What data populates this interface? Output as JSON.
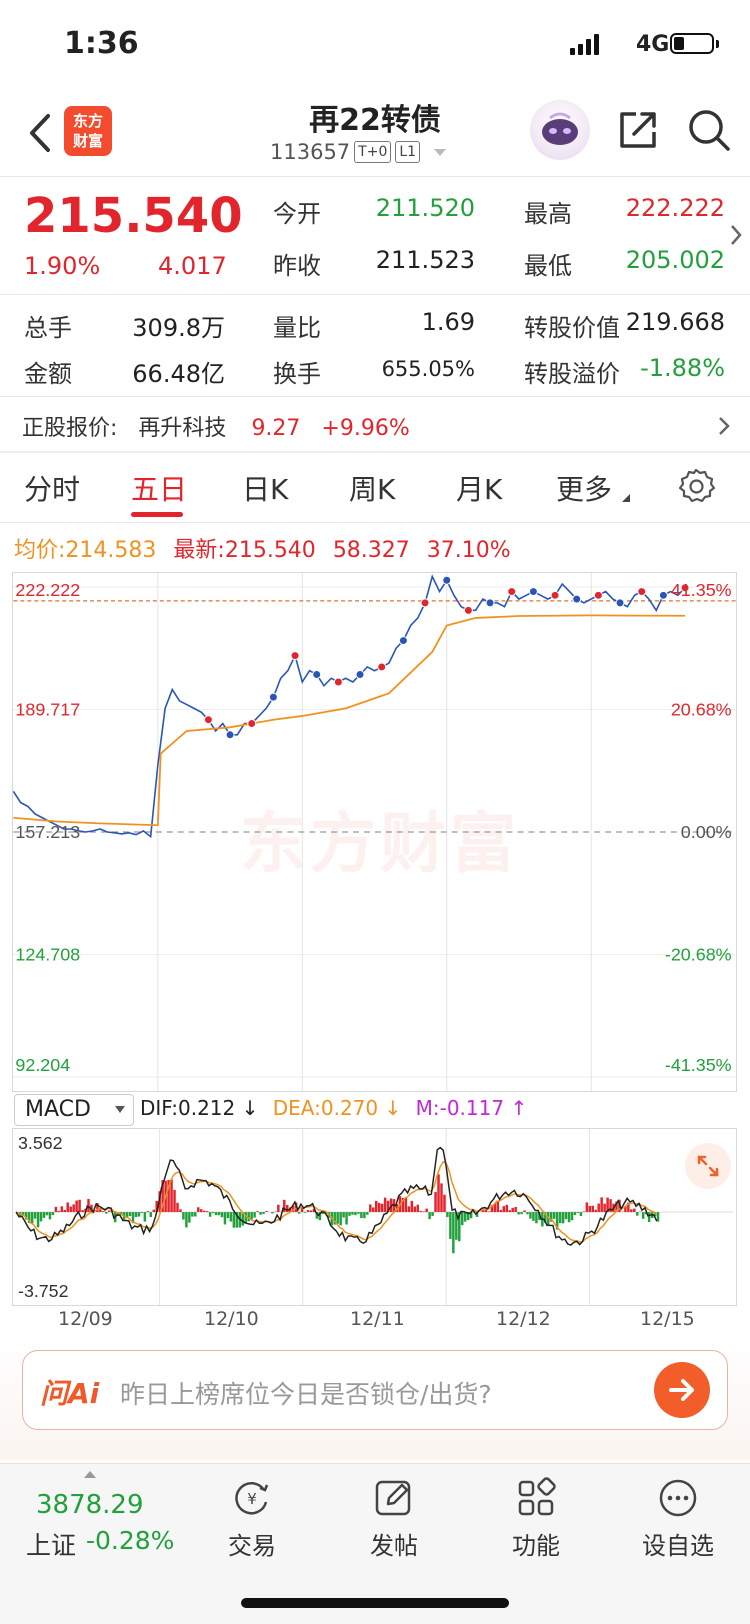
{
  "status": {
    "time": "1:36",
    "network": "4G"
  },
  "header": {
    "title": "再22转债",
    "code": "113657",
    "tag1": "T+0",
    "tag2": "L1",
    "logo_line1": "东方",
    "logo_line2": "财富"
  },
  "quote": {
    "price": "215.540",
    "change_pct": "1.90%",
    "change": "4.017",
    "rows": [
      [
        {
          "label": "今开",
          "value": "211.520",
          "color": "green"
        },
        {
          "label": "最高",
          "value": "222.222",
          "color": "red"
        }
      ],
      [
        {
          "label": "昨收",
          "value": "211.523",
          "color": "dark"
        },
        {
          "label": "最低",
          "value": "205.002",
          "color": "green"
        }
      ],
      [
        {
          "label": "总手",
          "value": "309.8万",
          "color": "dark"
        },
        {
          "label": "量比",
          "value": "1.69",
          "color": "dark"
        },
        {
          "label": "转股价值",
          "value": "219.668",
          "color": "dark"
        }
      ],
      [
        {
          "label": "金额",
          "value": "66.48亿",
          "color": "dark"
        },
        {
          "label": "换手",
          "value": "655.05%",
          "color": "dark"
        },
        {
          "label": "转股溢价",
          "value": "-1.88%",
          "color": "green"
        }
      ]
    ]
  },
  "underlying": {
    "label": "正股报价:",
    "name": "再升科技",
    "price": "9.27",
    "change_pct": "+9.96%"
  },
  "tabs": {
    "items": [
      "分时",
      "五日",
      "日K",
      "周K",
      "月K",
      "更多"
    ],
    "active": "五日"
  },
  "chart_info": {
    "avg_label": "均价:",
    "avg_value": "214.583",
    "latest_label": "最新:",
    "latest_value": "215.540",
    "change": "58.327",
    "change_pct": "37.10%"
  },
  "chart_data": {
    "type": "line",
    "title": "",
    "y_left_ticks": [
      "222.222",
      "189.717",
      "157.213",
      "124.708",
      "92.204"
    ],
    "y_right_ticks": [
      "41.35%",
      "20.68%",
      "0.00%",
      "-20.68%",
      "-41.35%"
    ],
    "ylim": [
      92.204,
      222.222
    ],
    "baseline": 157.213,
    "x_dates": [
      "12/09",
      "12/10",
      "12/11",
      "12/12",
      "12/15"
    ],
    "series": [
      {
        "name": "price",
        "color": "#2a55b8",
        "x": [
          0,
          0.05,
          0.1,
          0.15,
          0.2,
          0.25,
          0.3,
          0.35,
          0.4,
          0.45,
          0.5,
          0.55,
          0.6,
          0.65,
          0.7,
          0.75,
          0.8,
          0.85,
          0.9,
          0.95,
          1.0,
          1.05,
          1.1,
          1.15,
          1.2,
          1.25,
          1.3,
          1.35,
          1.4,
          1.45,
          1.5,
          1.55,
          1.6,
          1.65,
          1.7,
          1.75,
          1.8,
          1.85,
          1.9,
          1.95,
          2.0,
          2.05,
          2.1,
          2.15,
          2.2,
          2.25,
          2.3,
          2.35,
          2.4,
          2.45,
          2.5,
          2.55,
          2.6,
          2.65,
          2.7,
          2.75,
          2.8,
          2.85,
          2.9,
          2.95,
          3.0,
          3.05,
          3.1,
          3.15,
          3.2,
          3.25,
          3.3,
          3.35,
          3.4,
          3.45,
          3.5,
          3.55,
          3.6,
          3.65,
          3.7,
          3.75,
          3.8,
          3.85,
          3.9,
          3.95,
          4.0,
          4.05,
          4.1,
          4.15,
          4.2,
          4.25,
          4.3,
          4.35,
          4.4,
          4.45,
          4.5,
          4.55,
          4.6,
          4.65
        ],
        "y": [
          168,
          165,
          164,
          162,
          161,
          160,
          159,
          158,
          158,
          157.5,
          157.2,
          157.5,
          158,
          157.2,
          157,
          156.7,
          157,
          156.5,
          157.5,
          156,
          175,
          190,
          195,
          192,
          191,
          190,
          189,
          187,
          184,
          186,
          183,
          183,
          186,
          186,
          188,
          190,
          193,
          198,
          200,
          204,
          197,
          200,
          199,
          196,
          198,
          197,
          198,
          197,
          199,
          201,
          200,
          201,
          202,
          206,
          208,
          212,
          214,
          218,
          225,
          221,
          224,
          220,
          217,
          216,
          216,
          219,
          218,
          218,
          217,
          221,
          219,
          220,
          221,
          220,
          219,
          220,
          223,
          221,
          219,
          218,
          219,
          220,
          221,
          219,
          218,
          217,
          220,
          221,
          219,
          216,
          220,
          221,
          220,
          222
        ]
      },
      {
        "name": "avg",
        "color": "#f0921f",
        "x": [
          0,
          0.3,
          0.6,
          1.0,
          1.02,
          1.2,
          1.5,
          1.8,
          2.0,
          2.3,
          2.6,
          2.9,
          3.0,
          3.2,
          3.5,
          3.8,
          4.0,
          4.3,
          4.65
        ],
        "y": [
          161,
          160,
          159.5,
          159,
          178,
          184,
          185,
          187,
          188,
          190,
          194,
          205,
          212,
          214,
          214.5,
          214.6,
          214.7,
          214.6,
          214.583
        ]
      }
    ],
    "macd": {
      "label": "MACD",
      "dif_label": "DIF:",
      "dif": "0.212",
      "dea_label": "DEA:",
      "dea": "0.270",
      "m_label": "M:",
      "m": "-0.117",
      "ymax": "3.562",
      "ymin": "-3.752"
    }
  },
  "ai": {
    "logo": "问Ai",
    "prompt": "昨日上榜席位今日是否锁仓/出货?"
  },
  "bottom_nav": {
    "index_value": "3878.29",
    "index_name": "上证",
    "index_change": "-0.28%",
    "items": [
      "交易",
      "发帖",
      "功能",
      "设自选"
    ]
  },
  "watermark": "东方财富"
}
